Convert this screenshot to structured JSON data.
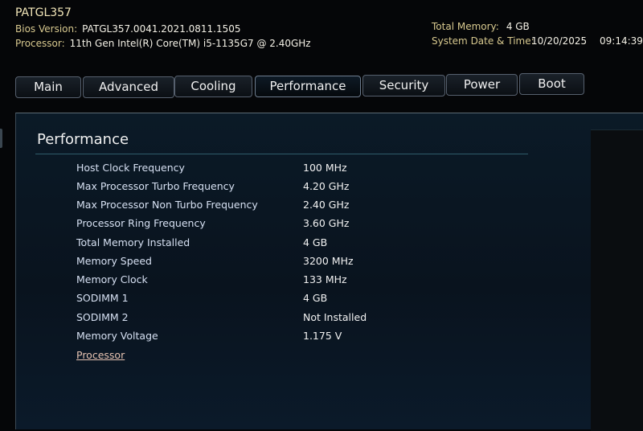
{
  "header": {
    "model": "PATGL357",
    "bios_label": "Bios Version:",
    "bios_value": "PATGL357.0041.2021.0811.1505",
    "processor_label": "Processor:",
    "processor_value": "11th Gen Intel(R) Core(TM) i5-1135G7 @ 2.40GHz",
    "memory_label": "Total Memory:",
    "memory_value": "4 GB",
    "datetime_label": "System Date & Time:",
    "date_value": "10/20/2025",
    "time_value": "09:14:39"
  },
  "tabs": [
    {
      "label": "Main"
    },
    {
      "label": "Advanced"
    },
    {
      "label": "Cooling"
    },
    {
      "label": "Performance"
    },
    {
      "label": "Security"
    },
    {
      "label": "Power"
    },
    {
      "label": "Boot"
    }
  ],
  "panel": {
    "title": "Performance",
    "rows": [
      {
        "label": "Host Clock Frequency",
        "value": "100 MHz"
      },
      {
        "label": "Max Processor Turbo Frequency",
        "value": "4.20 GHz"
      },
      {
        "label": "Max Processor Non Turbo Frequency",
        "value": "2.40 GHz"
      },
      {
        "label": "Processor Ring Frequency",
        "value": "3.60 GHz"
      },
      {
        "label": "Total Memory Installed",
        "value": "4 GB"
      },
      {
        "label": "Memory Speed",
        "value": "3200 MHz"
      },
      {
        "label": "Memory Clock",
        "value": "133 MHz"
      },
      {
        "label": "SODIMM 1",
        "value": "4 GB"
      },
      {
        "label": "SODIMM 2",
        "value": "Not Installed"
      },
      {
        "label": "Memory Voltage",
        "value": "1.175 V"
      }
    ],
    "link": "Processor"
  }
}
